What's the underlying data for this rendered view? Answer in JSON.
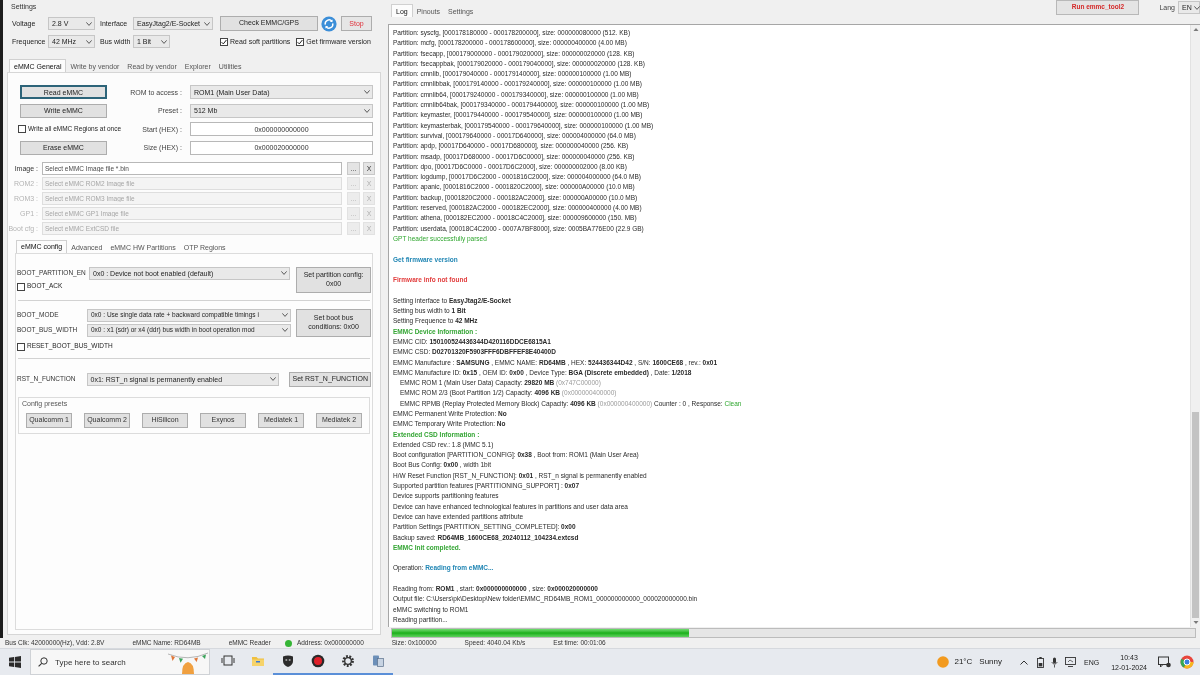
{
  "settings": {
    "title": "Settings",
    "voltage": {
      "label": "Voltage",
      "value": "2.8 V"
    },
    "interface": {
      "label": "Interface",
      "value": "EasyJtag2/E-Socket"
    },
    "check_button": "Check EMMC/GPS",
    "stop_button": "Stop",
    "frequence": {
      "label": "Frequence",
      "value": "42 MHz"
    },
    "bus_width": {
      "label": "Bus width",
      "value": "1 Bit"
    },
    "options": [
      {
        "label": "Read soft partitions",
        "checked": true
      },
      {
        "label": "Get firmware version",
        "checked": true
      }
    ]
  },
  "main_tabs": [
    {
      "label": "eMMC General",
      "selected": true
    },
    {
      "label": "Write by vendor",
      "selected": false
    },
    {
      "label": "Read by vendor",
      "selected": false
    },
    {
      "label": "Explorer",
      "selected": false
    },
    {
      "label": "Utilities",
      "selected": false
    }
  ],
  "operations": [
    {
      "kind": "button",
      "label": "Read eMMC",
      "focused": true
    },
    {
      "kind": "button",
      "label": "Write eMMC",
      "focused": false
    },
    {
      "kind": "checkbox",
      "label": "Write all eMMC Regions at once",
      "checked": false
    },
    {
      "kind": "button",
      "label": "Erase eMMC",
      "focused": false
    }
  ],
  "access_fields": [
    {
      "kind": "select",
      "label": "ROM to access :",
      "value": "ROM1 (Main User Data)"
    },
    {
      "kind": "select",
      "label": "Preset :",
      "value": "512 Mb"
    },
    {
      "kind": "input",
      "label": "Start (HEX) :",
      "value": "0x000000000000"
    },
    {
      "kind": "input",
      "label": "Size (HEX) :",
      "value": "0x000020000000"
    }
  ],
  "image_files": [
    {
      "label": "Image :",
      "placeholder": "Select eMMC Image file *.bin",
      "disabled": false,
      "browse_button": "...",
      "clear_button": "X"
    },
    {
      "label": "ROM2 :",
      "placeholder": "Select eMMC ROM2 Image file",
      "disabled": true,
      "browse_button": "...",
      "clear_button": "X"
    },
    {
      "label": "ROM3 :",
      "placeholder": "Select eMMC ROM3 Image file",
      "disabled": true,
      "browse_button": "...",
      "clear_button": "X"
    },
    {
      "label": "GP1 :",
      "placeholder": "Select eMMC GP1 Image file",
      "disabled": true,
      "browse_button": "...",
      "clear_button": "X"
    },
    {
      "label": "Boot cfg :",
      "placeholder": "Select eMMC ExtCSD file",
      "disabled": true,
      "browse_button": "...",
      "clear_button": "X"
    }
  ],
  "config_tabs": [
    {
      "label": "eMMC config",
      "selected": true
    },
    {
      "label": "Advanced",
      "selected": false
    },
    {
      "label": "eMMC HW Partitions",
      "selected": false
    },
    {
      "label": "OTP Regions",
      "selected": false
    }
  ],
  "boot_partition": {
    "label": "BOOT_PARTITION_EN",
    "value": "0x0 : Device not boot enabled (default)",
    "button": "Set partition config: 0x00",
    "boot_ack": {
      "label": "BOOT_ACK",
      "checked": false
    }
  },
  "boot_bus": {
    "mode": {
      "label": "BOOT_MODE",
      "value": "0x0 : Use single data rate + backward compatible timings i"
    },
    "width": {
      "label": "BOOT_BUS_WIDTH",
      "value": "0x0 : x1 (sdr) or x4 (ddr) bus width in boot operation mod"
    },
    "button": "Set boot bus conditions: 0x00",
    "reset_option": {
      "label": "RESET_BOOT_BUS_WIDTH",
      "checked": false
    }
  },
  "rst_n_function": {
    "label": "RST_N_FUNCTION",
    "value": "0x1: RST_n signal is permanently enabled",
    "button": "Set RST_N_FUNCTION"
  },
  "config_presets": {
    "title": "Config presets",
    "buttons": [
      "Qualcomm 1",
      "Qualcomm 2",
      "HiSilicon",
      "Exynos",
      "Mediatek 1",
      "Mediatek 2"
    ]
  },
  "log_panel": {
    "tabs": [
      {
        "label": "Log",
        "selected": true
      },
      {
        "label": "Pinouts",
        "selected": false
      },
      {
        "label": "Settings",
        "selected": false
      }
    ],
    "run_button": "Run emmc_tool2",
    "lang": {
      "label": "Lang",
      "value": "EN"
    },
    "lines": [
      {
        "kind": "plain",
        "text": "Partition: syscfg, [000178180000 - 000178200000], size: 000000080000 (512. KB)"
      },
      {
        "kind": "plain",
        "text": "Partition: mcfg, [000178200000 - 000178600000], size: 000000400000 (4.00 MB)"
      },
      {
        "kind": "plain",
        "text": "Partition: fsecapp, [000179000000 - 000179020000], size: 000000020000 (128. KB)"
      },
      {
        "kind": "plain",
        "text": "Partition: fsecappbak, [000179020000 - 000179040000], size: 000000020000 (128. KB)"
      },
      {
        "kind": "plain",
        "text": "Partition: cmnlib, [000179040000 - 000179140000], size: 000000100000 (1.00 MB)"
      },
      {
        "kind": "plain",
        "text": "Partition: cmnlibbak, [000179140000 - 000179240000], size: 000000100000 (1.00 MB)"
      },
      {
        "kind": "plain",
        "text": "Partition: cmnlib64, [000179240000 - 000179340000], size: 000000100000 (1.00 MB)"
      },
      {
        "kind": "plain",
        "text": "Partition: cmnlib64bak, [000179340000 - 000179440000], size: 000000100000 (1.00 MB)"
      },
      {
        "kind": "plain",
        "text": "Partition: keymaster, [000179440000 - 000179540000], size: 000000100000 (1.00 MB)"
      },
      {
        "kind": "plain",
        "text": "Partition: keymasterbak, [000179540000 - 000179640000], size: 000000100000 (1.00 MB)"
      },
      {
        "kind": "plain",
        "text": "Partition: survival, [000179640000 - 00017D640000], size: 000004000000 (64.0 MB)"
      },
      {
        "kind": "plain",
        "text": "Partition: apdp, [00017D640000 - 00017D680000], size: 000000040000 (256. KB)"
      },
      {
        "kind": "plain",
        "text": "Partition: msadp, [00017D680000 - 00017D6C0000], size: 000000040000 (256. KB)"
      },
      {
        "kind": "plain",
        "text": "Partition: dpo, [00017D6C0000 - 00017D6C2000], size: 000000002000 (8.00 KB)"
      },
      {
        "kind": "plain",
        "text": "Partition: logdump, [00017D6C2000 - 0001816C2000], size: 000004000000 (64.0 MB)"
      },
      {
        "kind": "plain",
        "text": "Partition: apanic, [0001816C2000 - 0001820C2000], size: 000000A00000 (10.0 MB)"
      },
      {
        "kind": "plain",
        "text": "Partition: backup, [0001820C2000 - 000182AC2000], size: 000000A00000 (10.0 MB)"
      },
      {
        "kind": "plain",
        "text": "Partition: reserved, [000182AC2000 - 000182EC2000], size: 000000400000 (4.00 MB)"
      },
      {
        "kind": "plain",
        "text": "Partition: athena, [000182EC2000 - 00018C4C2000], size: 000009600000 (150. MB)"
      },
      {
        "kind": "plain",
        "text": "Partition: userdata, [00018C4C2000 - 0007A7BF8000], size: 0005BA776E00 (22.9 GB)"
      },
      {
        "kind": "success",
        "text": "GPT header successfully parsed"
      },
      {
        "kind": "gap"
      },
      {
        "kind": "info",
        "text": "Get firmware version"
      },
      {
        "kind": "gap"
      },
      {
        "kind": "error",
        "text": "Firmware info not found"
      },
      {
        "kind": "gap"
      },
      {
        "kind": "plain",
        "text": "Setting interface to **EasyJtag2/E-Socket**"
      },
      {
        "kind": "plain",
        "text": "Setting bus width to **1 Bit**"
      },
      {
        "kind": "plain",
        "text": "Setting Frequence to **42 MHz**"
      },
      {
        "kind": "heading",
        "text": "EMMC Device Information :"
      },
      {
        "kind": "plain",
        "text": "EMMC CID: **150100524436344D420116DDCE6815A1**"
      },
      {
        "kind": "plain",
        "text": "EMMC CSD: **D02701320F5903FFF6DBFFEF8E40400D**"
      },
      {
        "kind": "plain",
        "text": "EMMC Manufacture : **SAMSUNG** , EMMC NAME: **RD64MB** , HEX: **524436344D42** , S/N: **1600CE68** , rev.: **0x01**"
      },
      {
        "kind": "plain",
        "text": "EMMC Manufacture ID: **0x15** , OEM ID: **0x00** , Device Type: **BGA (Discrete embedded)** , Date: **1/2018**"
      },
      {
        "kind": "detail",
        "parts": [
          {
            "text": "EMMC ROM 1 (Main User Data) Capacity: **29820 MB** ",
            "kind": "plain"
          },
          {
            "text": "(0x747C00000)",
            "kind": "muted"
          }
        ]
      },
      {
        "kind": "detail",
        "parts": [
          {
            "text": "EMMC ROM 2/3 (Boot Partition 1/2) Capacity: **4096 KB** ",
            "kind": "plain"
          },
          {
            "text": "(0x000000400000)",
            "kind": "muted"
          }
        ]
      },
      {
        "kind": "detail",
        "parts": [
          {
            "text": "EMMC RPMB (Replay Protected Memory Block) Capacity: **4096 KB** ",
            "kind": "plain"
          },
          {
            "text": "(0x000000400000)",
            "kind": "muted"
          },
          {
            "text": " Counter : 0 , Response: ",
            "kind": "plain"
          },
          {
            "text": "Clean",
            "kind": "success"
          }
        ]
      },
      {
        "kind": "plain",
        "text": "EMMC Permanent Write Protection: **No**"
      },
      {
        "kind": "plain",
        "text": "EMMC Temporary Write Protection: **No**"
      },
      {
        "kind": "heading",
        "text": "Extended CSD Information :"
      },
      {
        "kind": "plain",
        "text": "Extended CSD rev.: 1.8 (MMC 5.1)"
      },
      {
        "kind": "plain",
        "text": "Boot configuration [PARTITION_CONFIG]: **0x38** , Boot from: ROM1 (Main User Area)"
      },
      {
        "kind": "plain",
        "text": "Boot Bus Config: **0x00** , width 1bit"
      },
      {
        "kind": "plain",
        "text": "H/W Reset Function [RST_N_FUNCTION]: **0x01** , RST_n signal is permanently enabled"
      },
      {
        "kind": "plain",
        "text": "Supported partition features [PARTITIONING_SUPPORT] : **0x07**"
      },
      {
        "kind": "plain",
        "text": "Device supports partitioning features"
      },
      {
        "kind": "plain",
        "text": "Device can have enhanced technological features in partitions and user data area"
      },
      {
        "kind": "plain",
        "text": "Device can have extended partitions attribute"
      },
      {
        "kind": "plain",
        "text": "Partition Settings [PARTITION_SETTING_COMPLETED]: **0x00**"
      },
      {
        "kind": "plain",
        "text": "Backup saved: **RD64MB_1600CE68_20240112_104234.extcsd**"
      },
      {
        "kind": "heading",
        "text": "EMMC Init completed."
      },
      {
        "kind": "gap"
      },
      {
        "kind": "plain",
        "parts": [
          {
            "text": "Operation: ",
            "kind": "plain"
          },
          {
            "text": "Reading from eMMC...",
            "kind": "info"
          }
        ]
      },
      {
        "kind": "gap"
      },
      {
        "kind": "plain",
        "text": "Reading from: **ROM1** , start: **0x000000000000** , size: **0x000020000000**"
      },
      {
        "kind": "plain",
        "text": "Output file: C:\\Users\\pk\\Desktop\\New folder\\EMMC_RD64MB_ROM1_000000000000_000020000000.bin"
      },
      {
        "kind": "plain",
        "text": "eMMC switching to ROM1"
      },
      {
        "kind": "plain",
        "text": "Reading partition..."
      }
    ],
    "progress": {
      "level": 0.37
    }
  },
  "status_bar": [
    {
      "text": "Bus Clk: 42000000(Hz), Vdd: 2.8V"
    },
    {
      "text": "eMMC Name: RD64MB"
    },
    {
      "text": "eMMC Reader"
    },
    {
      "text": "Address: 0x000000000",
      "color": "#35b535"
    },
    {
      "text": "Size: 0x100000"
    },
    {
      "text": "Speed: 4040.04 Kb/s"
    },
    {
      "text": "Est time: 00:01:06"
    }
  ],
  "taskbar": {
    "search": {
      "placeholder": "Type here to search"
    },
    "apps": [
      {
        "kind": "task-view",
        "running": false
      },
      {
        "kind": "folder",
        "running": false
      },
      {
        "kind": "shield",
        "running": true
      },
      {
        "kind": "record",
        "running": true
      },
      {
        "kind": "gear",
        "running": true
      },
      {
        "kind": "device",
        "running": true
      }
    ],
    "weather": {
      "temperature": "21°C",
      "condition": "Sunny"
    },
    "language": "ENG",
    "time": "10:43",
    "date": "12-01-2024"
  }
}
